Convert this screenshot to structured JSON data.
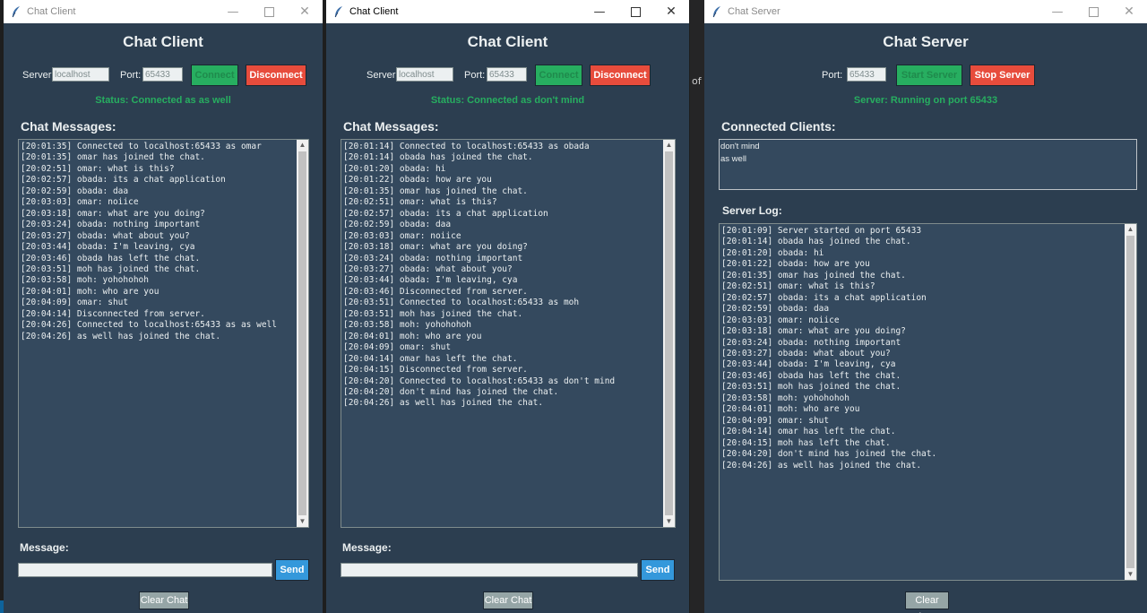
{
  "background": {
    "fragment_text": "of"
  },
  "client1": {
    "window_title": "Chat Client",
    "heading": "Chat Client",
    "server_label": "Server:",
    "server_value": "localhost",
    "port_label": "Port:",
    "port_value": "65433",
    "connect_label": "Connect",
    "disconnect_label": "Disconnect",
    "status": "Status: Connected as as well",
    "messages_label": "Chat Messages:",
    "log": "[20:01:35] Connected to localhost:65433 as omar\n[20:01:35] omar has joined the chat.\n[20:02:51] omar: what is this?\n[20:02:57] obada: its a chat application\n[20:02:59] obada: daa\n[20:03:03] omar: noiice\n[20:03:18] omar: what are you doing?\n[20:03:24] obada: nothing important\n[20:03:27] obada: what about you?\n[20:03:44] obada: I'm leaving, cya\n[20:03:46] obada has left the chat.\n[20:03:51] moh has joined the chat.\n[20:03:58] moh: yohohohoh\n[20:04:01] moh: who are you\n[20:04:09] omar: shut\n[20:04:14] Disconnected from server.\n[20:04:26] Connected to localhost:65433 as as well\n[20:04:26] as well has joined the chat.",
    "message_label": "Message:",
    "message_value": "",
    "send_label": "Send",
    "clear_label": "Clear Chat"
  },
  "client2": {
    "window_title": "Chat Client",
    "heading": "Chat Client",
    "server_label": "Server:",
    "server_value": "localhost",
    "port_label": "Port:",
    "port_value": "65433",
    "connect_label": "Connect",
    "disconnect_label": "Disconnect",
    "status": "Status: Connected as don't mind",
    "messages_label": "Chat Messages:",
    "log": "[20:01:14] Connected to localhost:65433 as obada\n[20:01:14] obada has joined the chat.\n[20:01:20] obada: hi\n[20:01:22] obada: how are you\n[20:01:35] omar has joined the chat.\n[20:02:51] omar: what is this?\n[20:02:57] obada: its a chat application\n[20:02:59] obada: daa\n[20:03:03] omar: noiice\n[20:03:18] omar: what are you doing?\n[20:03:24] obada: nothing important\n[20:03:27] obada: what about you?\n[20:03:44] obada: I'm leaving, cya\n[20:03:46] Disconnected from server.\n[20:03:51] Connected to localhost:65433 as moh\n[20:03:51] moh has joined the chat.\n[20:03:58] moh: yohohohoh\n[20:04:01] moh: who are you\n[20:04:09] omar: shut\n[20:04:14] omar has left the chat.\n[20:04:15] Disconnected from server.\n[20:04:20] Connected to localhost:65433 as don't mind\n[20:04:20] don't mind has joined the chat.\n[20:04:26] as well has joined the chat.",
    "message_label": "Message:",
    "message_value": "",
    "send_label": "Send",
    "clear_label": "Clear Chat"
  },
  "server": {
    "window_title": "Chat Server",
    "heading": "Chat Server",
    "port_label": "Port:",
    "port_value": "65433",
    "start_label": "Start Server",
    "stop_label": "Stop Server",
    "status": "Server: Running on port 65433",
    "clients_label": "Connected Clients:",
    "clients": "don't mind\nas well",
    "log_label": "Server Log:",
    "log": "[20:01:09] Server started on port 65433\n[20:01:14] obada has joined the chat.\n[20:01:20] obada: hi\n[20:01:22] obada: how are you\n[20:01:35] omar has joined the chat.\n[20:02:51] omar: what is this?\n[20:02:57] obada: its a chat application\n[20:02:59] obada: daa\n[20:03:03] omar: noiice\n[20:03:18] omar: what are you doing?\n[20:03:24] obada: nothing important\n[20:03:27] obada: what about you?\n[20:03:44] obada: I'm leaving, cya\n[20:03:46] obada has left the chat.\n[20:03:51] moh has joined the chat.\n[20:03:58] moh: yohohohoh\n[20:04:01] moh: who are you\n[20:04:09] omar: shut\n[20:04:14] omar has left the chat.\n[20:04:15] moh has left the chat.\n[20:04:20] don't mind has joined the chat.\n[20:04:26] as well has joined the chat.",
    "clear_label": "Clear Log"
  },
  "icons": {
    "app_icon": "feather-icon",
    "minimize": "minimize-icon",
    "maximize": "maximize-icon",
    "close": "close-icon"
  },
  "colors": {
    "window_bg": "#2c3e50",
    "panel_bg": "#34495e",
    "text": "#ecf0f1",
    "status_green": "#27ae60",
    "button_red": "#e74c3c",
    "button_blue": "#3498db",
    "button_gray": "#95a5a6"
  }
}
